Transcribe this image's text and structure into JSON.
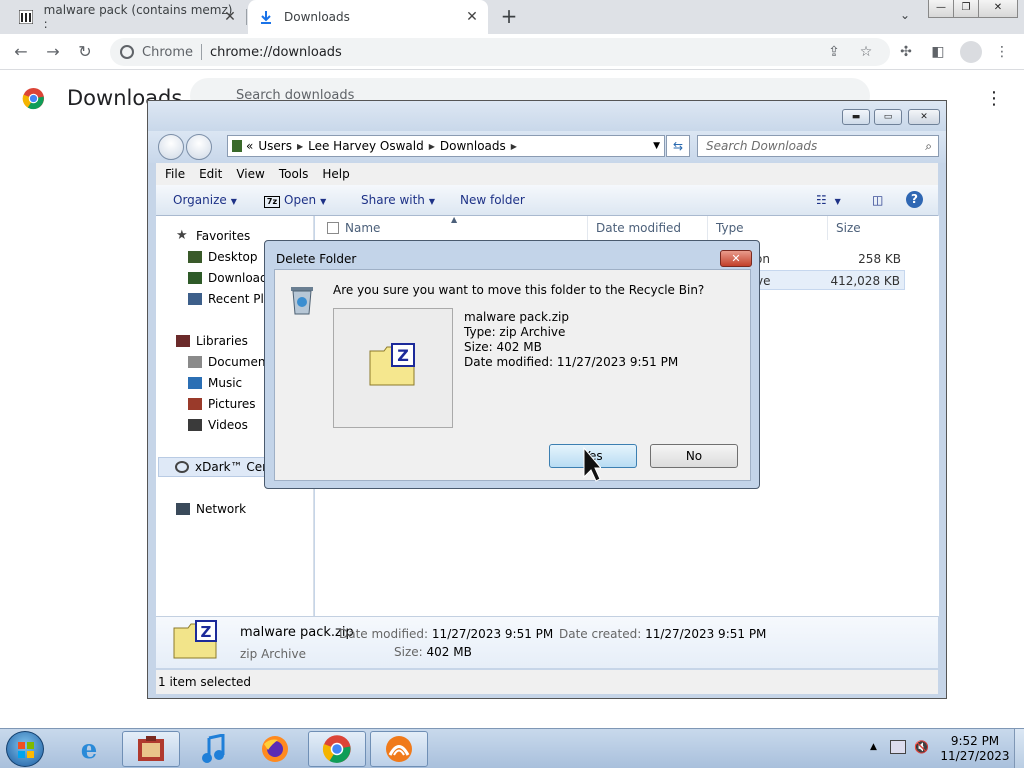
{
  "chrome": {
    "tabs": [
      {
        "title": "malware pack (contains memz) :"
      },
      {
        "title": "Downloads"
      }
    ],
    "new_tab_label": "+",
    "omnibox": {
      "site_label": "Chrome",
      "url": "chrome://downloads"
    }
  },
  "downloads_page": {
    "title": "Downloads",
    "search_placeholder": "Search downloads"
  },
  "explorer": {
    "breadcrumbs": [
      "Users",
      "Lee Harvey Oswald",
      "Downloads"
    ],
    "crumb_prefix": "«",
    "search_placeholder": "Search Downloads",
    "menu": [
      "File",
      "Edit",
      "View",
      "Tools",
      "Help"
    ],
    "commands": {
      "organize": "Organize",
      "open": "Open",
      "share": "Share with",
      "new_folder": "New folder"
    },
    "nav": {
      "favorites": "Favorites",
      "desktop": "Desktop",
      "downloads": "Downloads",
      "recent": "Recent Plac",
      "libraries": "Libraries",
      "documents": "Documents",
      "music": "Music",
      "pictures": "Pictures",
      "videos": "Videos",
      "xdark": "xDark™ Cente",
      "network": "Network"
    },
    "columns": {
      "name": "Name",
      "date": "Date modified",
      "type": "Type",
      "size": "Size"
    },
    "rows": [
      {
        "type_partial": "on",
        "size": "258 KB"
      },
      {
        "type_partial": "ve",
        "size": "412,028 KB"
      }
    ],
    "details": {
      "filename": "malware pack.zip",
      "type": "zip Archive",
      "date_modified_label": "Date modified:",
      "date_modified": "11/27/2023 9:51 PM",
      "date_created_label": "Date created:",
      "date_created": "11/27/2023 9:51 PM",
      "size_label": "Size:",
      "size": "402 MB"
    },
    "status": "1 item selected"
  },
  "dialog": {
    "title": "Delete Folder",
    "question": "Are you sure you want to move this folder to the Recycle Bin?",
    "info": {
      "name": "malware pack.zip",
      "type": "Type: zip Archive",
      "size": "Size: 402 MB",
      "date": "Date modified: 11/27/2023 9:51 PM"
    },
    "yes": "Yes",
    "no": "No"
  },
  "taskbar": {
    "time": "9:52 PM",
    "date": "11/27/2023"
  }
}
